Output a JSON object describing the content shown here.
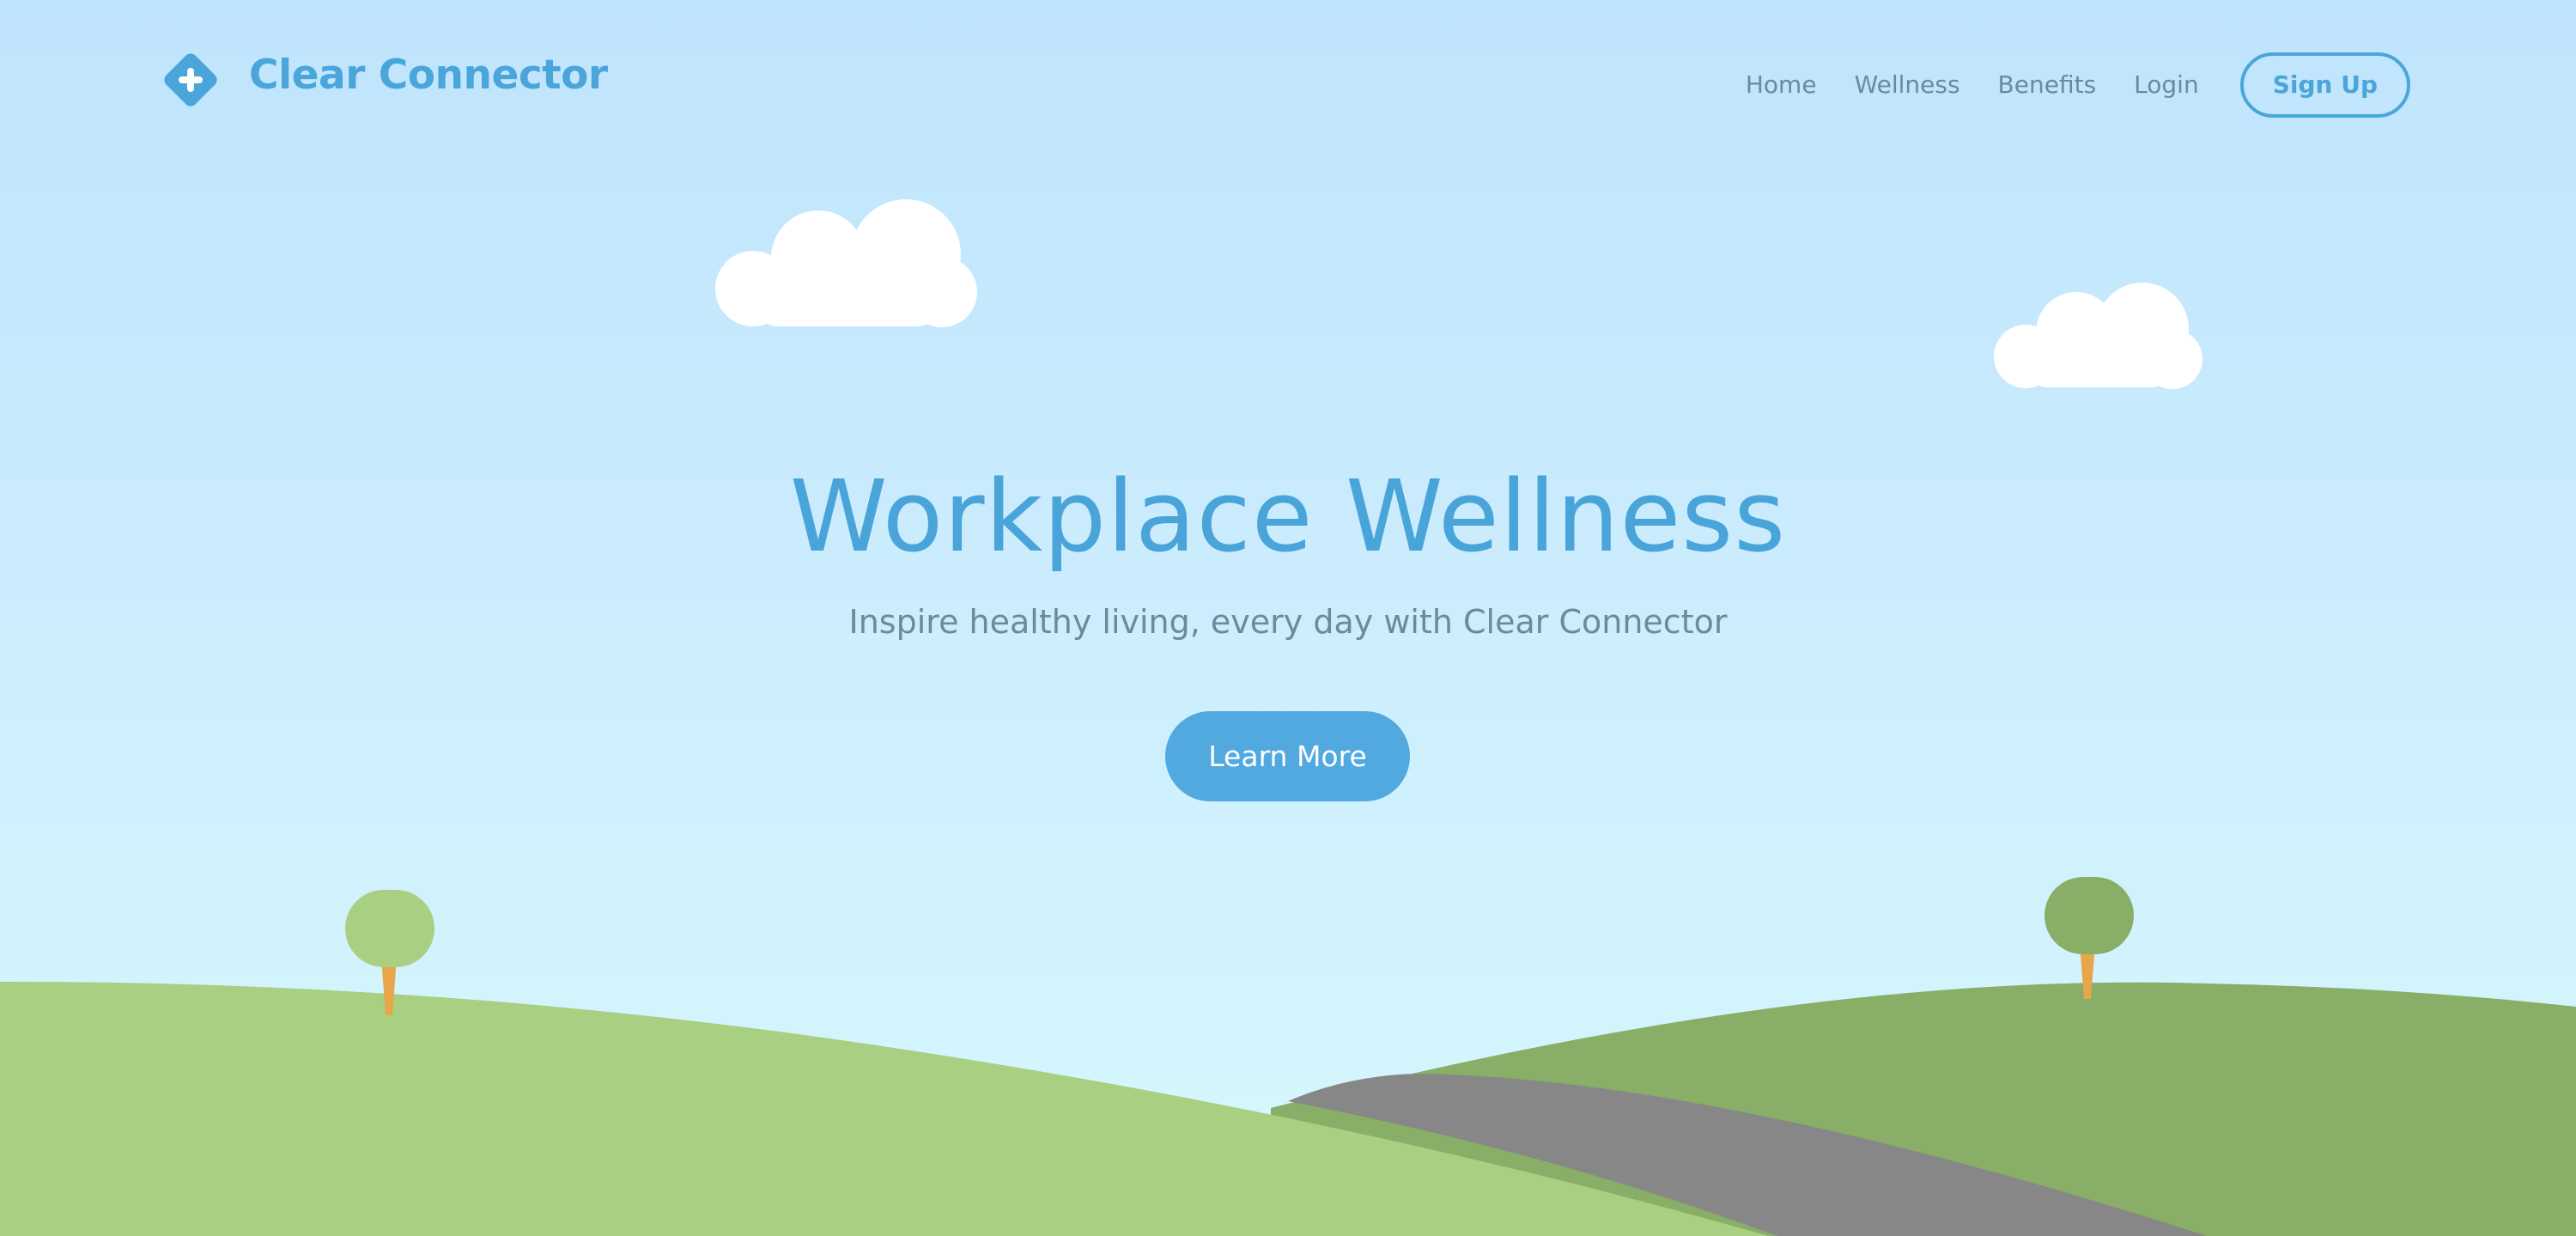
{
  "brand": {
    "name": "Clear Connector",
    "logo_icon": "plus-diamond-icon"
  },
  "nav": {
    "items": [
      {
        "label": "Home"
      },
      {
        "label": "Wellness"
      },
      {
        "label": "Benefits"
      },
      {
        "label": "Login"
      }
    ],
    "signup_label": "Sign Up"
  },
  "hero": {
    "title": "Workplace Wellness",
    "subtitle": "Inspire healthy living, every day with Clear Connector",
    "cta_label": "Learn More"
  },
  "colors": {
    "accent": "#4aa6da",
    "sky_top": "#bfe4fd",
    "sky_bottom": "#d8f8fd",
    "hill_light": "#a8cf82",
    "hill_dark": "#88ae67",
    "road": "#878787",
    "trunk": "#e8a64a"
  }
}
